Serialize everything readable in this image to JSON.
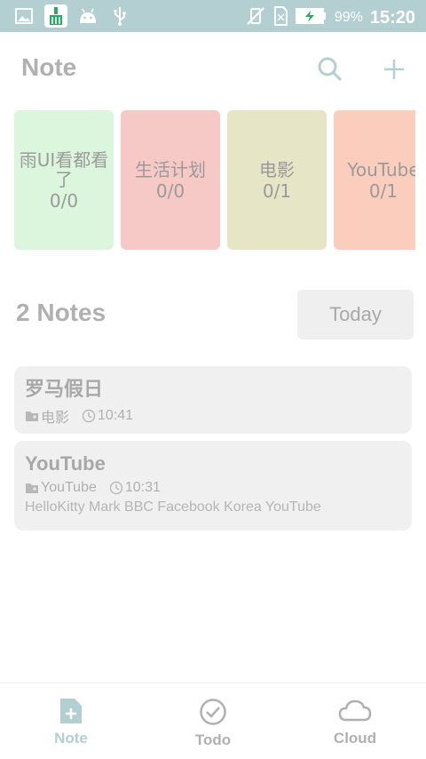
{
  "status_bar": {
    "left_icons": [
      "gallery-icon",
      "cleaner-app-icon",
      "android-icon",
      "usb-icon"
    ],
    "right_icons": [
      "vibrate-off-icon",
      "sim-off-icon",
      "battery-charging-icon"
    ],
    "battery_percent": "99%",
    "time": "15:20",
    "background_color": "#b3cfd1"
  },
  "header": {
    "title": "Note",
    "search_icon": "search-icon",
    "add_icon": "plus-icon"
  },
  "categories": [
    {
      "name": "雨UI看都看了",
      "count": "0/0",
      "color": "#dcf6de"
    },
    {
      "name": "生活计划",
      "count": "0/0",
      "color": "#f6c9c6"
    },
    {
      "name": "电影",
      "count": "0/1",
      "color": "#e6e6c7"
    },
    {
      "name": "YouTube",
      "count": "0/1",
      "color": "#fbcdbd"
    }
  ],
  "notes_header": {
    "count_label": "2 Notes",
    "today_button": "Today"
  },
  "notes": [
    {
      "title": "罗马假日",
      "folder": "电影",
      "time": "10:41",
      "body": ""
    },
    {
      "title": "YouTube",
      "folder": "YouTube",
      "time": "10:31",
      "body": "HelloKitty Mark BBC Facebook Korea YouTube"
    }
  ],
  "bottom_nav": [
    {
      "label": "Note",
      "icon": "note-add-icon",
      "active": true
    },
    {
      "label": "Todo",
      "icon": "check-circle-icon",
      "active": false
    },
    {
      "label": "Cloud",
      "icon": "cloud-icon",
      "active": false
    }
  ],
  "colors": {
    "accent": "#b3cfd1",
    "card_gray": "#f0f0f0"
  }
}
